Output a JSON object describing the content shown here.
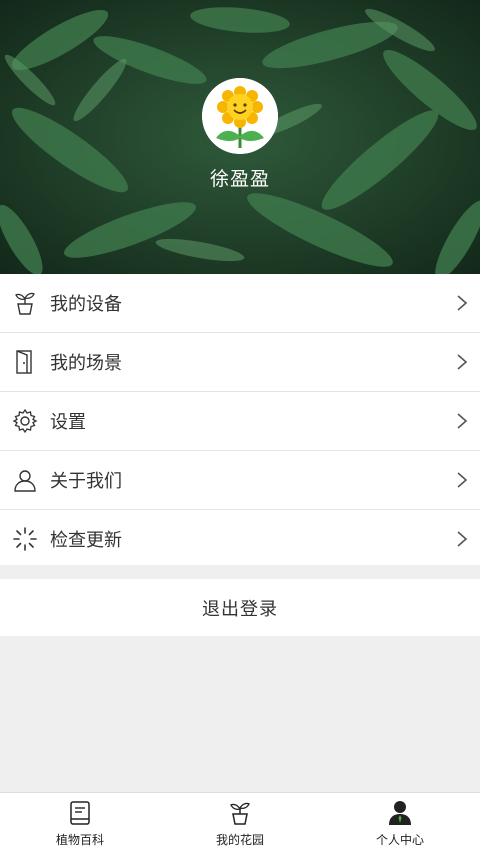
{
  "profile": {
    "username": "徐盈盈"
  },
  "menu": {
    "items": [
      {
        "label": "我的设备",
        "icon": "plant-pot-icon"
      },
      {
        "label": "我的场景",
        "icon": "door-icon"
      },
      {
        "label": "设置",
        "icon": "gear-icon"
      },
      {
        "label": "关于我们",
        "icon": "user-icon"
      },
      {
        "label": "检查更新",
        "icon": "loading-icon"
      }
    ]
  },
  "logout": {
    "label": "退出登录"
  },
  "tabbar": {
    "tabs": [
      {
        "label": "植物百科",
        "icon": "book-icon"
      },
      {
        "label": "我的花园",
        "icon": "plant-pot-icon"
      },
      {
        "label": "个人中心",
        "icon": "person-icon",
        "active": true
      }
    ]
  },
  "colors": {
    "hero_bg": "#1d3a26",
    "accent": "#2e7d32",
    "text": "#333333",
    "divider": "#e4e4e4"
  }
}
